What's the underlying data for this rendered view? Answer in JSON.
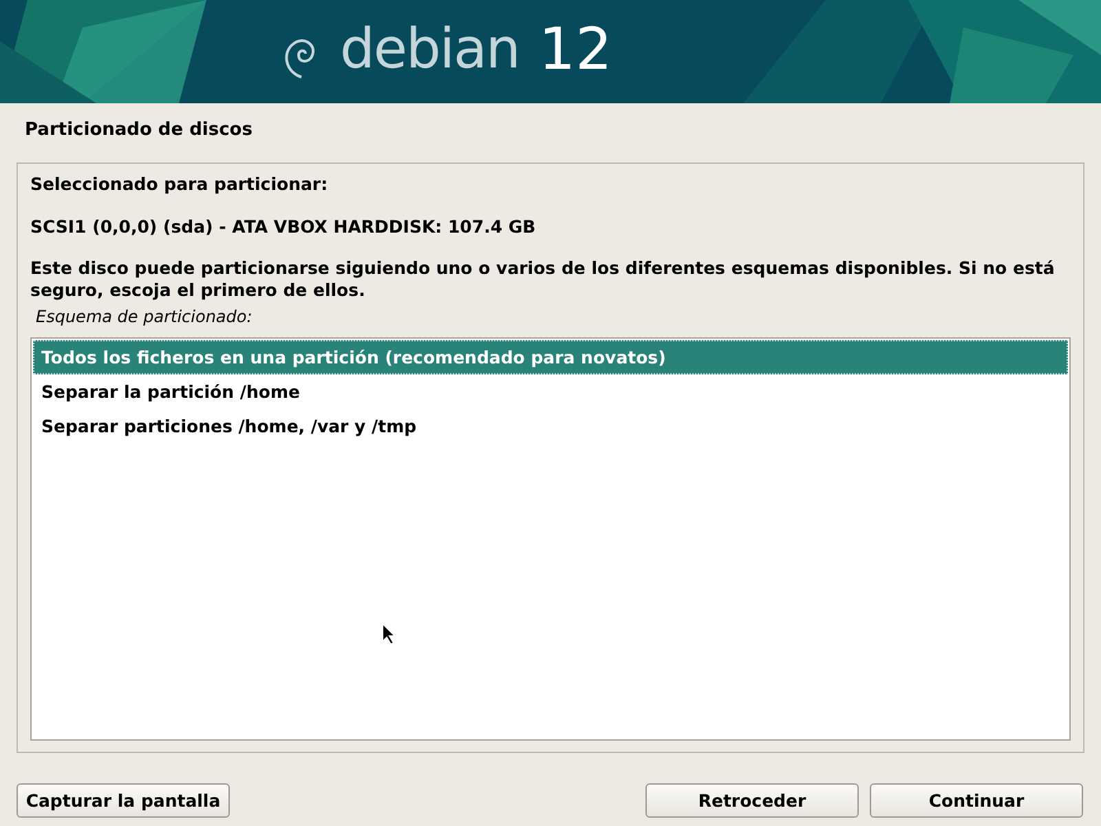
{
  "banner": {
    "brand": "debian",
    "version": "12"
  },
  "title": "Particionado de discos",
  "selected_label": "Seleccionado para particionar:",
  "disk": "SCSI1 (0,0,0) (sda) - ATA VBOX HARDDISK: 107.4 GB",
  "description": "Este disco puede particionarse siguiendo uno o varios de los diferentes esquemas disponibles. Si no está seguro, escoja el primero de ellos.",
  "list_label": "Esquema de particionado:",
  "options": [
    {
      "label": "Todos los ficheros en una partición (recomendado para novatos)",
      "selected": true
    },
    {
      "label": "Separar la partición /home",
      "selected": false
    },
    {
      "label": "Separar particiones /home, /var y /tmp",
      "selected": false
    }
  ],
  "buttons": {
    "screenshot": "Capturar la pantalla",
    "back": "Retroceder",
    "continue": "Continuar"
  }
}
